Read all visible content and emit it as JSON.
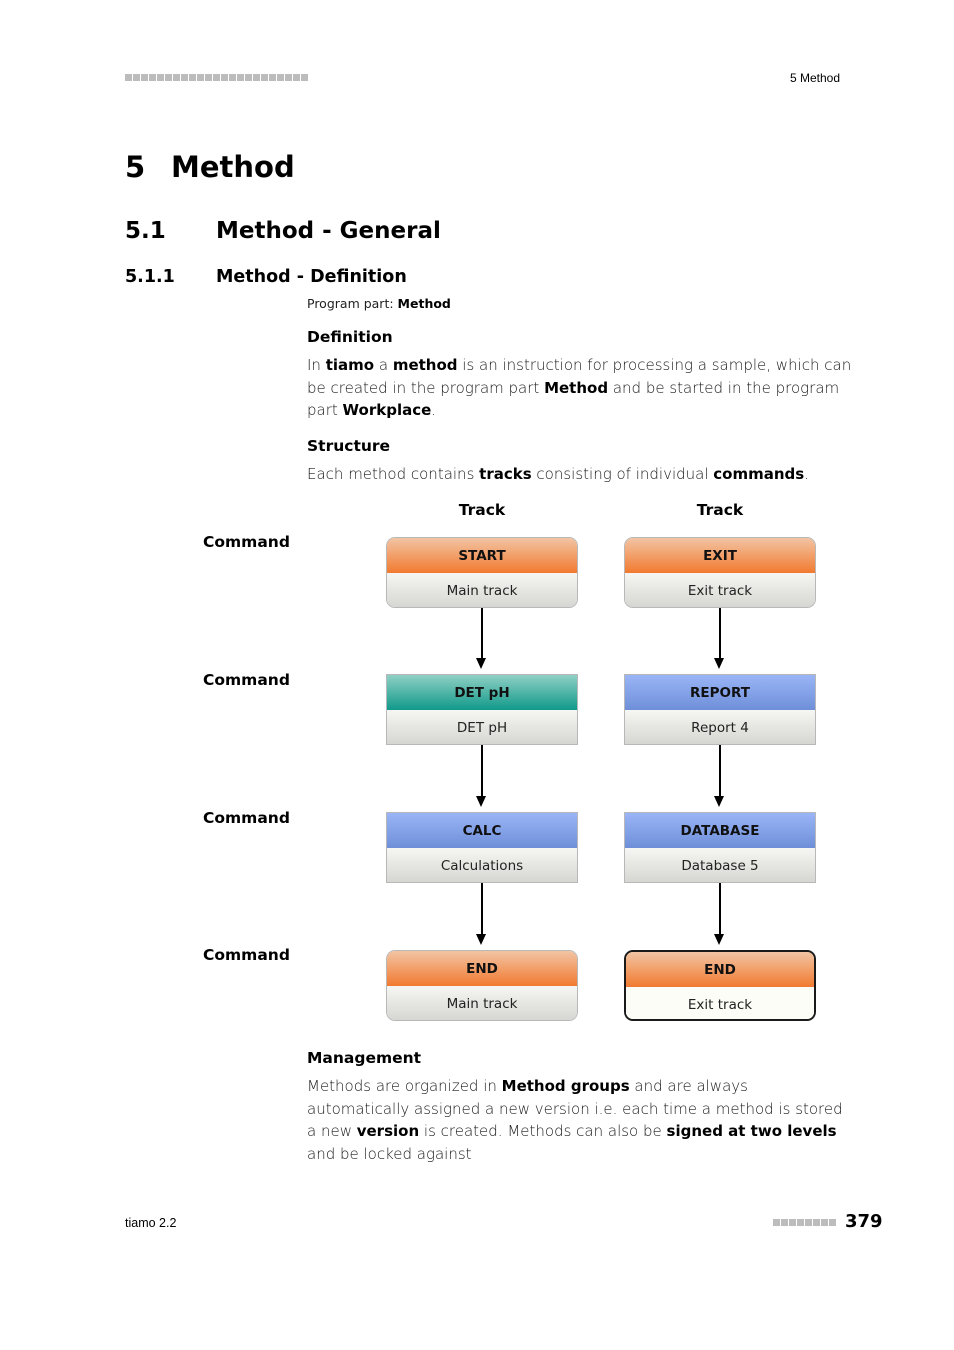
{
  "header": {
    "running_title": "5 Method",
    "decor_squares": 23
  },
  "headings": {
    "chapter": {
      "number": "5",
      "title": "Method"
    },
    "section": {
      "number": "5.1",
      "title": "Method - General"
    },
    "subsection": {
      "number": "5.1.1",
      "title": "Method - Definition"
    }
  },
  "program_part": {
    "label": "Program part:",
    "value": "Method"
  },
  "definition": {
    "title": "Definition",
    "segments": [
      {
        "t": "In "
      },
      {
        "b": "tiamo"
      },
      {
        "t": " a "
      },
      {
        "b": "method"
      },
      {
        "t": " is an instruction for processing a sample, which can be created in the program part "
      },
      {
        "b": "Method"
      },
      {
        "t": " and be started in the program part "
      },
      {
        "b": "Workplace"
      },
      {
        "t": "."
      }
    ]
  },
  "structure": {
    "title": "Structure",
    "segments": [
      {
        "t": "Each method contains "
      },
      {
        "b": "tracks"
      },
      {
        "t": " consisting of individual "
      },
      {
        "b": "commands"
      },
      {
        "t": "."
      }
    ]
  },
  "diagram": {
    "track_labels": [
      "Track",
      "Track"
    ],
    "command_labels": [
      "Command",
      "Command",
      "Command",
      "Command"
    ],
    "tracks": [
      {
        "nodes": [
          {
            "name": "START",
            "subtitle": "Main track",
            "color": "orange",
            "rounded": true,
            "selected": false
          },
          {
            "name": "DET pH",
            "subtitle": "DET pH",
            "color": "teal",
            "rounded": false,
            "selected": false
          },
          {
            "name": "CALC",
            "subtitle": "Calculations",
            "color": "blue",
            "rounded": false,
            "selected": false
          },
          {
            "name": "END",
            "subtitle": "Main track",
            "color": "orange",
            "rounded": true,
            "selected": false
          }
        ]
      },
      {
        "nodes": [
          {
            "name": "EXIT",
            "subtitle": "Exit track",
            "color": "orange",
            "rounded": true,
            "selected": false
          },
          {
            "name": "REPORT",
            "subtitle": "Report 4",
            "color": "blue",
            "rounded": false,
            "selected": false
          },
          {
            "name": "DATABASE",
            "subtitle": "Database 5",
            "color": "blue",
            "rounded": false,
            "selected": false
          },
          {
            "name": "END",
            "subtitle": "Exit track",
            "color": "orange",
            "rounded": true,
            "selected": true
          }
        ]
      }
    ]
  },
  "management": {
    "title": "Management",
    "segments": [
      {
        "t": "Methods are organized in "
      },
      {
        "b": "Method groups"
      },
      {
        "t": " and are always automatically assigned a new version i.e. each time a method is stored a new "
      },
      {
        "b": "version"
      },
      {
        "t": " is created. Methods can also be "
      },
      {
        "b": "signed at two levels"
      },
      {
        "t": " and be locked against"
      }
    ]
  },
  "footer": {
    "product": "tiamo 2.2",
    "page_number": "379",
    "decor_squares": 8
  }
}
